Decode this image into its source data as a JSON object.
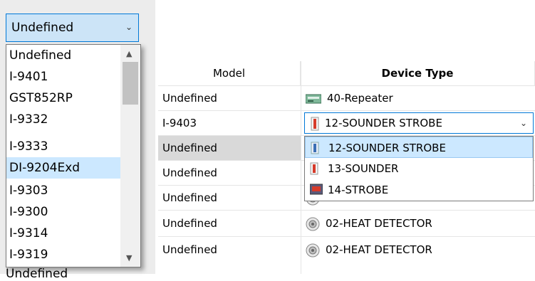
{
  "model_combo": {
    "selected": "Undefined",
    "options": [
      "Undefined",
      "I-9401",
      "GST852RP",
      "I-9332",
      "I-9333",
      "DI-9204Exd",
      "I-9303",
      "I-9300",
      "I-9314",
      "I-9319"
    ],
    "highlighted": "DI-9204Exd",
    "partial_below": "Undefined"
  },
  "table": {
    "headers": {
      "model": "Model",
      "device_type": "Device Type"
    },
    "rows": [
      {
        "model": "Undefined",
        "device_type": "40-Repeater",
        "icon": "repeater-icon"
      },
      {
        "model": "I-9403",
        "device_type": "12-SOUNDER STROBE",
        "icon": "sounder-strobe-icon"
      },
      {
        "model": "Undefined",
        "device_type": "",
        "icon": ""
      },
      {
        "model": "Undefined",
        "device_type": "",
        "icon": ""
      },
      {
        "model": "Undefined",
        "device_type": "02-HEAT DETECTOR",
        "icon": "heat-detector-icon"
      },
      {
        "model": "Undefined",
        "device_type": "02-HEAT DETECTOR",
        "icon": "heat-detector-icon"
      },
      {
        "model": "Undefined",
        "device_type": "02-HEAT DETECTOR",
        "icon": "heat-detector-icon"
      }
    ]
  },
  "device_type_dropdown": {
    "selected": "12-SOUNDER STROBE",
    "options": [
      "12-SOUNDER STROBE",
      "13-SOUNDER",
      "14-STROBE"
    ]
  },
  "colors": {
    "accent": "#0078d7",
    "selection": "#cce8ff",
    "row_highlight": "#d9d9d9"
  }
}
